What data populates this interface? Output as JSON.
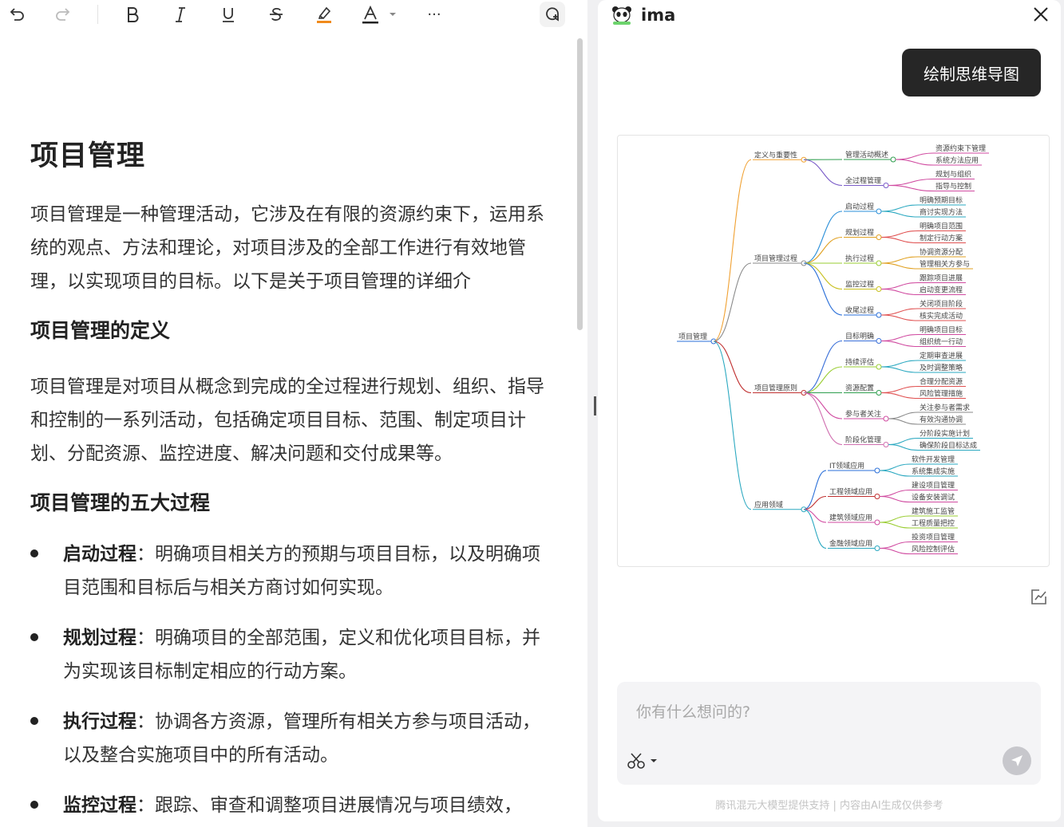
{
  "toolbar": {
    "more_label": "···"
  },
  "document": {
    "title": "项目管理",
    "intro": "项目管理是一种管理活动，它涉及在有限的资源约束下，运用系统的观点、方法和理论，对项目涉及的全部工作进行有效地管理，以实现项目的目标。以下是关于项目管理的详细介",
    "section1": {
      "heading": "项目管理的定义",
      "body": "项目管理是对项目从概念到完成的全过程进行规划、组织、指导和控制的一系列活动，包括确定项目目标、范围、制定项目计划、分配资源、监控进度、解决问题和交付成果等。"
    },
    "section2": {
      "heading": "项目管理的五大过程",
      "bullets": [
        {
          "term": "启动过程",
          "sep": "：",
          "text": "明确项目相关方的预期与项目目标，以及明确项目范围和目标后与相关方商讨如何实现。"
        },
        {
          "term": "规划过程",
          "sep": "：",
          "text": "明确项目的全部范围，定义和优化项目目标，并为实现该目标制定相应的行动方案。"
        },
        {
          "term": "执行过程",
          "sep": "：",
          "text": "协调各方资源，管理所有相关方参与项目活动，以及整合实施项目中的所有活动。"
        },
        {
          "term": "监控过程",
          "sep": "：",
          "text": "跟踪、审查和调整项目进展情况与项目绩效，"
        }
      ]
    }
  },
  "assistant": {
    "app_name": "ima",
    "user_message": "绘制思维导图",
    "input_placeholder": "你有什么想问的?",
    "footer": "腾讯混元大模型提供支持 | 内容由AI生成仅供参考"
  },
  "mindmap": {
    "root": "项目管理",
    "branches": [
      {
        "label": "定义与重要性",
        "color": "#f0a030",
        "children": [
          {
            "label": "管理活动概述",
            "color": "#2e9e4e",
            "leaves": [
              "资源约束下管理",
              "系统方法应用"
            ],
            "leaf_color": "#d04aa0"
          },
          {
            "label": "全过程管理",
            "color": "#7a5cc8",
            "leaves": [
              "规划与组织",
              "指导与控制"
            ],
            "leaf_color": "#d04aa0"
          }
        ]
      },
      {
        "label": "项目管理过程",
        "color": "#8a8a8a",
        "children": [
          {
            "label": "启动过程",
            "color": "#2a8fd8",
            "leaves": [
              "明确预期目标",
              "商讨实现方法"
            ],
            "leaf_color": "#2aa8c0"
          },
          {
            "label": "规划过程",
            "color": "#e0a020",
            "leaves": [
              "明确项目范围",
              "制定行动方案"
            ],
            "leaf_color": "#e05050"
          },
          {
            "label": "执行过程",
            "color": "#9acd32",
            "leaves": [
              "协调资源分配",
              "管理相关方参与"
            ],
            "leaf_color": "#e0a020"
          },
          {
            "label": "监控过程",
            "color": "#c8c020",
            "leaves": [
              "跟踪项目进展",
              "启动变更流程"
            ],
            "leaf_color": "#d04aa0"
          },
          {
            "label": "收尾过程",
            "color": "#2a6fd8",
            "leaves": [
              "关闭项目阶段",
              "核实完成活动"
            ],
            "leaf_color": "#e05050"
          }
        ]
      },
      {
        "label": "项目管理原则",
        "color": "#c03030",
        "children": [
          {
            "label": "目标明确",
            "color": "#3a6fd8",
            "leaves": [
              "明确项目目标",
              "组织统一行动"
            ],
            "leaf_color": "#d04aa0"
          },
          {
            "label": "持续评估",
            "color": "#9acd32",
            "leaves": [
              "定期审查进展",
              "及时调整策略"
            ],
            "leaf_color": "#2aa8c0"
          },
          {
            "label": "资源配置",
            "color": "#2e9e4e",
            "leaves": [
              "合理分配资源",
              "风险管理措施"
            ],
            "leaf_color": "#e05050"
          },
          {
            "label": "参与者关注",
            "color": "#d04aa0",
            "leaves": [
              "关注参与者需求",
              "有效沟通协调"
            ],
            "leaf_color": "#8a8a8a"
          },
          {
            "label": "阶段化管理",
            "color": "#d070b0",
            "leaves": [
              "分阶段实施计划",
              "确保阶段目标达成"
            ],
            "leaf_color": "#2aa8c0"
          }
        ]
      },
      {
        "label": "应用领域",
        "color": "#2aa8c0",
        "children": [
          {
            "label": "IT领域应用",
            "color": "#2a6fd8",
            "leaves": [
              "软件开发管理",
              "系统集成实施"
            ],
            "leaf_color": "#2aa8c0"
          },
          {
            "label": "工程领域应用",
            "color": "#c03030",
            "leaves": [
              "建设项目管理",
              "设备安装调试"
            ],
            "leaf_color": "#d04aa0"
          },
          {
            "label": "建筑领域应用",
            "color": "#d04aa0",
            "leaves": [
              "建筑施工监管",
              "工程质量把控"
            ],
            "leaf_color": "#9acd32"
          },
          {
            "label": "金融领域应用",
            "color": "#2aa8c0",
            "leaves": [
              "投资项目管理",
              "风险控制评估"
            ],
            "leaf_color": "#d04aa0"
          }
        ]
      }
    ]
  }
}
